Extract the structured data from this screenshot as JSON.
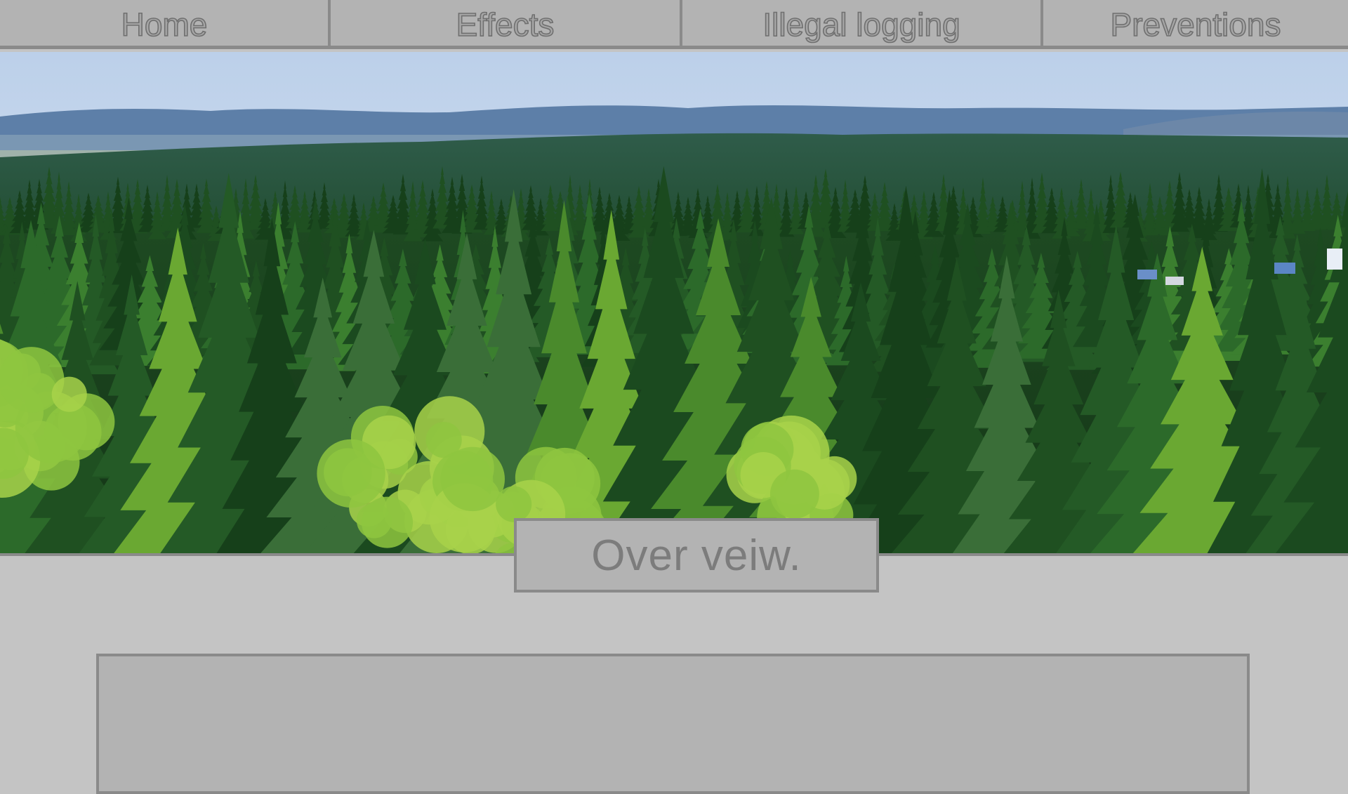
{
  "nav": {
    "items": [
      {
        "label": "Home"
      },
      {
        "label": "Effects"
      },
      {
        "label": "Illegal logging"
      },
      {
        "label": "Preventions"
      }
    ]
  },
  "hero": {
    "image": "forest-landscape"
  },
  "overview": {
    "heading": "Over veiw."
  },
  "colors": {
    "page_bg": "#c4c4c4",
    "nav_bg": "#b3b3b3",
    "border": "#8a8a8a",
    "text": "#7c7c7c"
  }
}
